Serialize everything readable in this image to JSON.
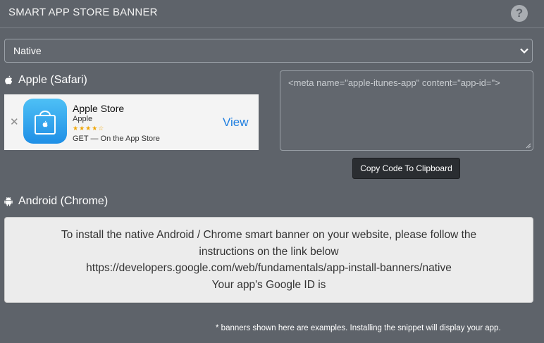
{
  "header": {
    "title": "SMART APP STORE BANNER",
    "help_icon": "question-circle-icon",
    "help_glyph": "?"
  },
  "type_select": {
    "value": "Native"
  },
  "apple": {
    "label": "Apple (Safari)",
    "banner": {
      "close_glyph": "✕",
      "app_name": "Apple Store",
      "developer": "Apple",
      "stars": "★★★★☆",
      "rating_stars": 4,
      "get_text": "GET — On the App Store",
      "view_label": "View"
    },
    "code": "<meta name=\"apple-itunes-app\" content=\"app-id=\">",
    "copy_button": "Copy Code To Clipboard"
  },
  "android": {
    "label": "Android (Chrome)",
    "info_lines": [
      "To install the native Android / Chrome smart banner on your website, please follow the",
      "instructions on the link below",
      "https://developers.google.com/web/fundamentals/app-install-banners/native",
      "Your app's Google ID is"
    ]
  },
  "footnote": "* banners shown here are examples. Installing the snippet will display your app.",
  "colors": {
    "background": "#5e636a",
    "link_blue": "#1f7fe0",
    "app_icon_blue": "#2a9ff0",
    "star_orange": "#f0a500"
  }
}
